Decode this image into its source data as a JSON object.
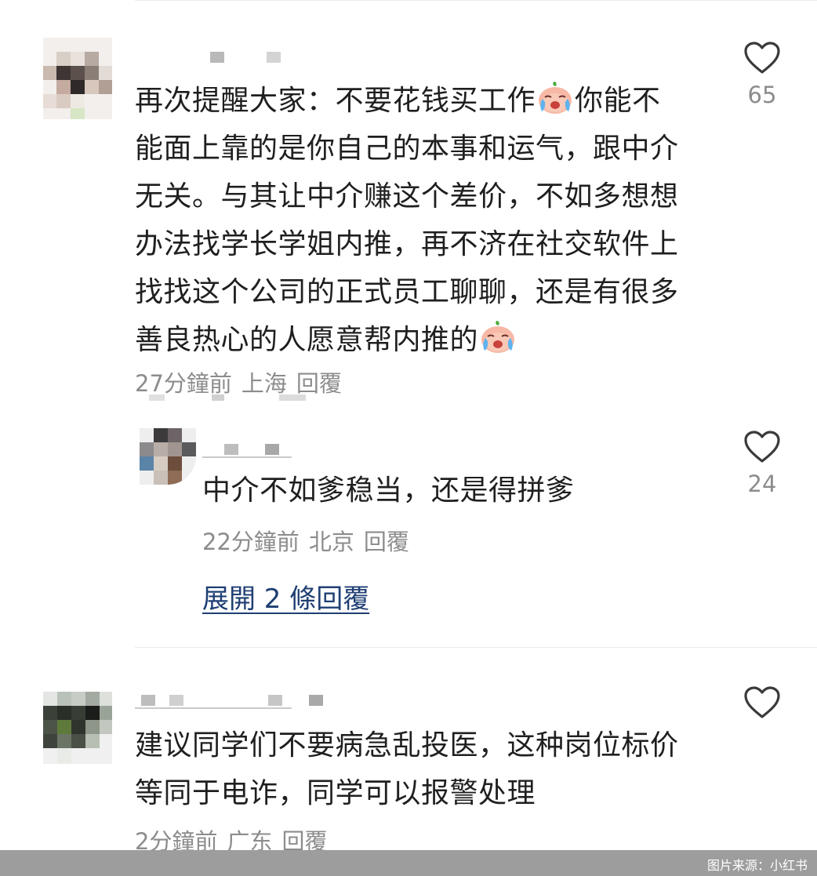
{
  "comments": [
    {
      "text_parts": [
        "再次提醒大家：不要花钱买工作",
        "你能不\n能面上靠的是你自己的本事和运气，跟中介\n无关。与其让中介赚这个差价，不如多想想\n办法找学长学姐内推，再不济在社交软件上\n找找这个公司的正式员工聊聊，还是有很多\n善良热心的人愿意帮内推的",
        ""
      ],
      "emoji": "crying-face-emoji",
      "time": "27分鐘前",
      "location": "上海",
      "reply_label": "回覆",
      "likes": "65"
    },
    {
      "text": "中介不如爹稳当，还是得拼爹",
      "time": "22分鐘前",
      "location": "北京",
      "reply_label": "回覆",
      "likes": "24",
      "expand_label": "展開 2 條回覆"
    },
    {
      "text": "建议同学们不要病急乱投医，这种岗位标价\n等同于电诈，同学可以报警处理",
      "time": "2分鐘前",
      "location": "广东",
      "reply_label": "回覆",
      "likes": ""
    }
  ],
  "image_source": "图片来源：小红书",
  "colors": {
    "text": "#1f1f1f",
    "meta": "#8c8c8c",
    "link": "#1f3f73",
    "footer": "#9d9d9d"
  }
}
